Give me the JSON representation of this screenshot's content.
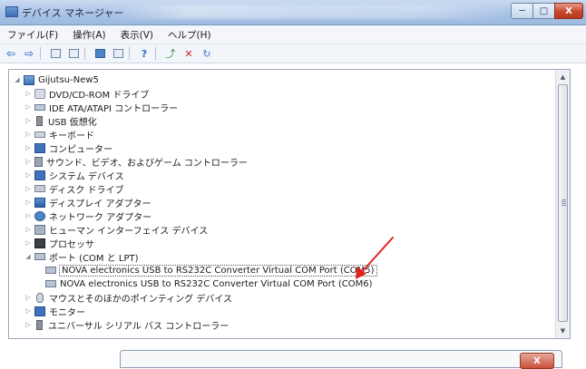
{
  "window": {
    "title": "デバイス マネージャー",
    "minimize_glyph": "─",
    "maximize_glyph": "□",
    "close_glyph": "X"
  },
  "menu": [
    {
      "label": "ファイル(F)"
    },
    {
      "label": "操作(A)"
    },
    {
      "label": "表示(V)"
    },
    {
      "label": "ヘルプ(H)"
    }
  ],
  "toolbar": {
    "back_icon": "back-arrow-icon",
    "forward_icon": "forward-arrow-icon",
    "glyph_back": "⇦",
    "glyph_fwd": "⇨",
    "glyph_help": "?",
    "glyph_update": "⤴",
    "glyph_remove": "✕",
    "glyph_scan": "↻"
  },
  "tree": {
    "root": "Gijutsu-New5",
    "items": [
      {
        "label": "DVD/CD-ROM ドライブ",
        "icon": "optical-drive-icon",
        "expanded": false
      },
      {
        "label": "IDE ATA/ATAPI コントローラー",
        "icon": "ide-controller-icon",
        "expanded": false
      },
      {
        "label": "USB 仮想化",
        "icon": "usb-icon",
        "expanded": false
      },
      {
        "label": "キーボード",
        "icon": "keyboard-icon",
        "expanded": false
      },
      {
        "label": "コンピューター",
        "icon": "computer-icon",
        "expanded": false
      },
      {
        "label": "サウンド、ビデオ、およびゲーム コントローラー",
        "icon": "speaker-icon",
        "expanded": false
      },
      {
        "label": "システム デバイス",
        "icon": "system-device-icon",
        "expanded": false
      },
      {
        "label": "ディスク ドライブ",
        "icon": "disk-drive-icon",
        "expanded": false
      },
      {
        "label": "ディスプレイ アダプター",
        "icon": "display-adapter-icon",
        "expanded": false
      },
      {
        "label": "ネットワーク アダプター",
        "icon": "network-adapter-icon",
        "expanded": false
      },
      {
        "label": "ヒューマン インターフェイス デバイス",
        "icon": "hid-icon",
        "expanded": false
      },
      {
        "label": "プロセッサ",
        "icon": "processor-icon",
        "expanded": false
      },
      {
        "label": "ポート (COM と LPT)",
        "icon": "port-icon",
        "expanded": true
      },
      {
        "label": "マウスとそのほかのポインティング デバイス",
        "icon": "mouse-icon",
        "expanded": false
      },
      {
        "label": "モニター",
        "icon": "monitor-icon",
        "expanded": false
      },
      {
        "label": "ユニバーサル シリアル バス コントローラー",
        "icon": "usb-controller-icon",
        "expanded": false
      }
    ],
    "ports": [
      {
        "label": "NOVA electronics USB to RS232C Converter Virtual COM Port (COM5)",
        "icon": "com-port-icon"
      },
      {
        "label": "NOVA electronics USB to RS232C Converter Virtual COM Port (COM6)",
        "icon": "com-port-icon"
      }
    ],
    "expanded_glyph": "◢",
    "collapsed_glyph": "▷"
  },
  "scrollbar": {
    "up_glyph": "▲",
    "down_glyph": "▼"
  },
  "annotation": {
    "color": "#e3221b"
  },
  "dialog": {
    "close_label": "X"
  }
}
